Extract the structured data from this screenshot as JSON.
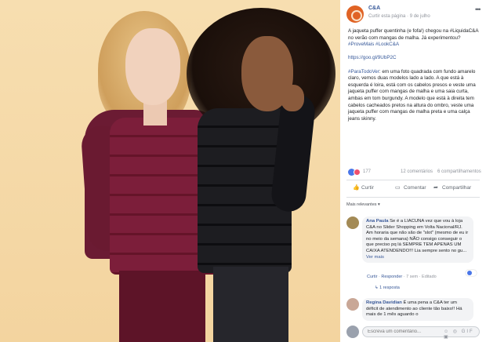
{
  "post": {
    "page_name": "C&A",
    "follow_label": "Curtir esta página",
    "date": "9 de julho",
    "more_icon": "ellipsis-icon",
    "paragraphs": [
      [
        "A jaqueta puffer quentinha (e fofa!) chegou na #LiquidaC&A no verão com mangas de malha. Já experimentou? ",
        "#ProveMais",
        " #LookC&A"
      ],
      [
        "https://goo.gl/9UbP2C"
      ],
      [
        "",
        "#ParaTodoVer",
        ": em uma foto quadrada com fundo amarelo claro, vemos duas modelos lado a lado. A que está à esquerda é loira, está com os cabelos presos e veste uma jaqueta puffer com mangas de malha e uma saia curta, ambas em tom burgundy. A modelo que está à direita tem cabelos cacheados pretos na altura do ombro, veste uma jaqueta puffer com mangas de malha preta e uma calça jeans skinny."
      ]
    ]
  },
  "reactions": {
    "count": "177",
    "comments": "12 comentários",
    "shares": "6 compartilhamentos"
  },
  "actions": {
    "like": "Curtir",
    "comment": "Comentar",
    "share": "Compartilhar"
  },
  "sort_label": "Mais relevantes ▾",
  "comments": [
    {
      "name": "Ana Paula",
      "text": "Se é a LIACUNA vez que vou à loja C&A no Slider Shopping em Volta Nacional/RJ. Am horaria que não são de \"slot\" (mesmo de eu ir no meio da semana) NÃO consigo conseguir o que preciso pq lá SEMPRE TEM APENAS UM CAIXA ATENDENDO!!! Lia sempre sento no gu...",
      "more": "Ver mais",
      "like": "Curtir",
      "reply": "Responder",
      "time": "7 sem",
      "edited": "Editado",
      "replies": "1 resposta"
    },
    {
      "name": "Regina Davidian",
      "text": "É uma pena a C&A ter um déficit de atendimento ao cliente tão baixo!! Há mais de 1 mês aguardo o"
    }
  ],
  "composer": {
    "placeholder": "Escreva um comentário...",
    "icons": "☺ ◎ GIF ▣"
  },
  "colors": {
    "link": "#365899",
    "background": "#f3d49f",
    "brand": "#e06325"
  }
}
